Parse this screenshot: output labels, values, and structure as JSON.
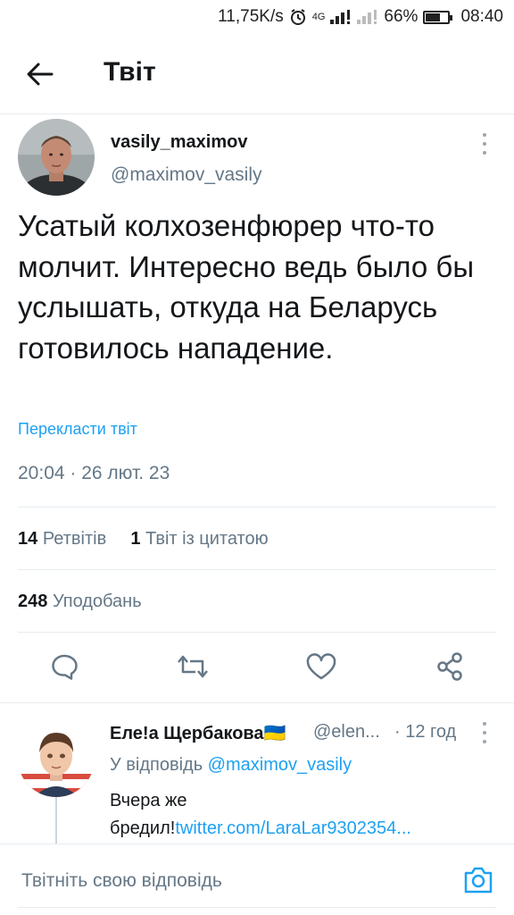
{
  "status_bar": {
    "net_speed": "11,75K/s",
    "network": "4G",
    "battery_percent": "66%",
    "battery_level": 0.66,
    "time": "08:40"
  },
  "header": {
    "title": "Твіт"
  },
  "tweet": {
    "author_name": "vasily_maximov",
    "author_handle": "@maximov_vasily",
    "text": "Усатый колхозенфюрер что-то молчит. Интересно ведь было бы услышать, откуда на Беларусь готовилось нападение.",
    "translate_label": "Перекласти твіт",
    "timestamp": "20:04 · 26 лют. 23",
    "retweets_count": "14",
    "retweets_label": "Ретвітів",
    "quotes_count": "1",
    "quotes_label": "Твіт із цитатою",
    "likes_count": "248",
    "likes_label": "Уподобань"
  },
  "reply": {
    "author_name": "Еле!а Щербакова",
    "flag": "🇺🇦",
    "author_handle": "@elen...",
    "time": "· 12 год",
    "reply_to_prefix": "У відповідь ",
    "reply_to_handle": "@maximov_vasily",
    "text": "Вчера же бредил!",
    "link": "twitter.com/LaraLar9302354..."
  },
  "composer": {
    "placeholder": "Твітніть свою відповідь"
  },
  "colors": {
    "accent": "#1da1f2",
    "muted": "#657786",
    "text": "#14171a",
    "divider": "#e6ecf0"
  },
  "icons": {
    "back": "arrow-left-icon",
    "more": "more-vertical-icon",
    "reply": "comment-icon",
    "retweet": "retweet-icon",
    "like": "heart-icon",
    "share": "share-icon",
    "camera": "camera-icon"
  }
}
